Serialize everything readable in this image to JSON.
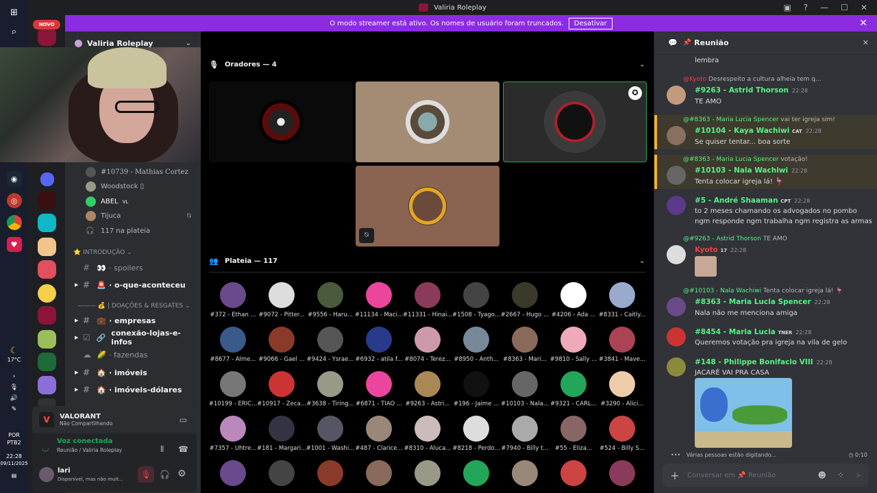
{
  "window": {
    "title": "Valiria Roleplay"
  },
  "banner": {
    "text": "O modo streamer está ativo. Os nomes de usuário foram truncados.",
    "button": "Desativar"
  },
  "badge": "NOVO",
  "taskbar": {
    "weather": "17°C",
    "lang1": "POR",
    "lang2": "PTB2",
    "time": "22:28",
    "date": "09/11/2025"
  },
  "server": {
    "name": "Valiria Roleplay"
  },
  "voice_users": [
    {
      "name": "#10739 - Mathias Cortez"
    },
    {
      "name": "Woodstock ▯"
    },
    {
      "name": "ABEL",
      "tag": "VL"
    },
    {
      "name": "Tijuca"
    },
    {
      "name": "117 na plateia"
    }
  ],
  "categories": {
    "intro": "INTRODUÇÃO",
    "doacoes": "| DOAÇÕES & RESGATES"
  },
  "channels": [
    {
      "icon": "#",
      "emoji": "👀",
      "name": "spoilers"
    },
    {
      "icon": "#",
      "emoji": "🚨",
      "name": "o-que-aconteceu"
    },
    {
      "icon": "#",
      "emoji": "💼",
      "name": "empresas"
    },
    {
      "icon": "☑",
      "emoji": "🔗",
      "name": "conexão-lojas-e-infos"
    },
    {
      "icon": "",
      "emoji": "🌽",
      "name": "fazendas"
    },
    {
      "icon": "#",
      "emoji": "🏠",
      "name": "imóveis"
    },
    {
      "icon": "#",
      "emoji": "🏠",
      "name": "imóveis-dólares"
    }
  ],
  "activity": {
    "game": "VALORANT",
    "status": "Não Compartilhando"
  },
  "voice": {
    "status": "Voz conectada",
    "location": "Reunião / Valiria Roleplay"
  },
  "user": {
    "name": "lari",
    "status": "Disponível, mas não muit..."
  },
  "stage": {
    "speakers_title": "Oradores — 4",
    "audience_title": "Plateia — 117"
  },
  "audience": [
    "#372 - Ethan ...",
    "#9072 - Pitter...",
    "#9556 - Haru...",
    "#11134 - Maci...",
    "#11331 - Hinai...",
    "#1508 - Tyago...",
    "#2667 - Hugo ...",
    "#4206 - Ada ...",
    "#8331 - Caitly...",
    "#8677 - Alme...",
    "#9066 - Gael ...",
    "#9424 - Ysrae...",
    "#6932 - atila f...",
    "#8074 - Terez...",
    "#8950 - Anth...",
    "#8363 - Mari...",
    "#9810 - Sally ...",
    "#3841 - Mave...",
    "#10199 - ERIC...",
    "#10917 - Zeca...",
    "#3638 - Tiring...",
    "#6871 - TIAO ...",
    "#9263 - Astri...",
    "#196 - Jaime ...",
    "#10103 - Nala...",
    "#9321 - CARL...",
    "#3290 - Alici...",
    "#7357 - Uhtre...",
    "#181 - Margari...",
    "#1001 - Washi...",
    "#487 - Clarice...",
    "#8310 - Aluca...",
    "#8218 - Perdo...",
    "#7940 - Billy t...",
    "#55 - Eliza...",
    "#524 - Billy S..."
  ],
  "chat": {
    "title": "Reunião",
    "top_text": "lembra",
    "messages": [
      {
        "reply_user": "@Kyoto",
        "reply": "Desrespeito a cultura alheia tem q...",
        "name": "#9263 - Astrid Thorson",
        "time": "22:28",
        "text": "TE AMO"
      },
      {
        "reply_user": "@#8363 - Maria Lucia Spencer",
        "reply": "vai ter igreja sim!",
        "name": "#10104 - Kaya Wachiwi",
        "tag": "CAT",
        "time": "22:28",
        "text": "Se quiser tentar... boa sorte"
      },
      {
        "reply_user": "@#8363 - Maria Lucia Spencer",
        "reply": "votação!",
        "name": "#10103 - Nala Wachiwi",
        "time": "22:28",
        "text": "Tenta colocar igreja lá! 🦩"
      },
      {
        "name": "#5 - André Shaaman",
        "tag": "CPT",
        "time": "22:28",
        "text": "to 2 meses chamando os advogados no pombo",
        "text2": "ngm responde ngm trabalha ngm registra as armas"
      },
      {
        "reply_user": "@#9263 - Astrid Thorson",
        "reply": "TE AMO",
        "name": "Kyoto",
        "tag": "17",
        "time": "22:28"
      },
      {
        "reply_user": "@#10103 - Nala Wachiwi",
        "reply": "Tenta colocar igreja lá! 🦩",
        "name": "#8363 - Maria Lucia Spencer",
        "time": "22:28",
        "text": "Nala não me menciona amiga"
      },
      {
        "name": "#8454 - Maria  Lucia",
        "tag": "TNER",
        "time": "22:28",
        "text": "Queremos votação pra igreja na vila de gelo"
      },
      {
        "name": "#148 - Philippe Bonifacio VIII",
        "time": "22:28",
        "text": "JACARÉ VAI PRA CASA"
      }
    ],
    "typing": "Várias pessoas estão digitando...",
    "timer": "0:10",
    "input_placeholder": "Conversar em 📌 Reunião"
  }
}
